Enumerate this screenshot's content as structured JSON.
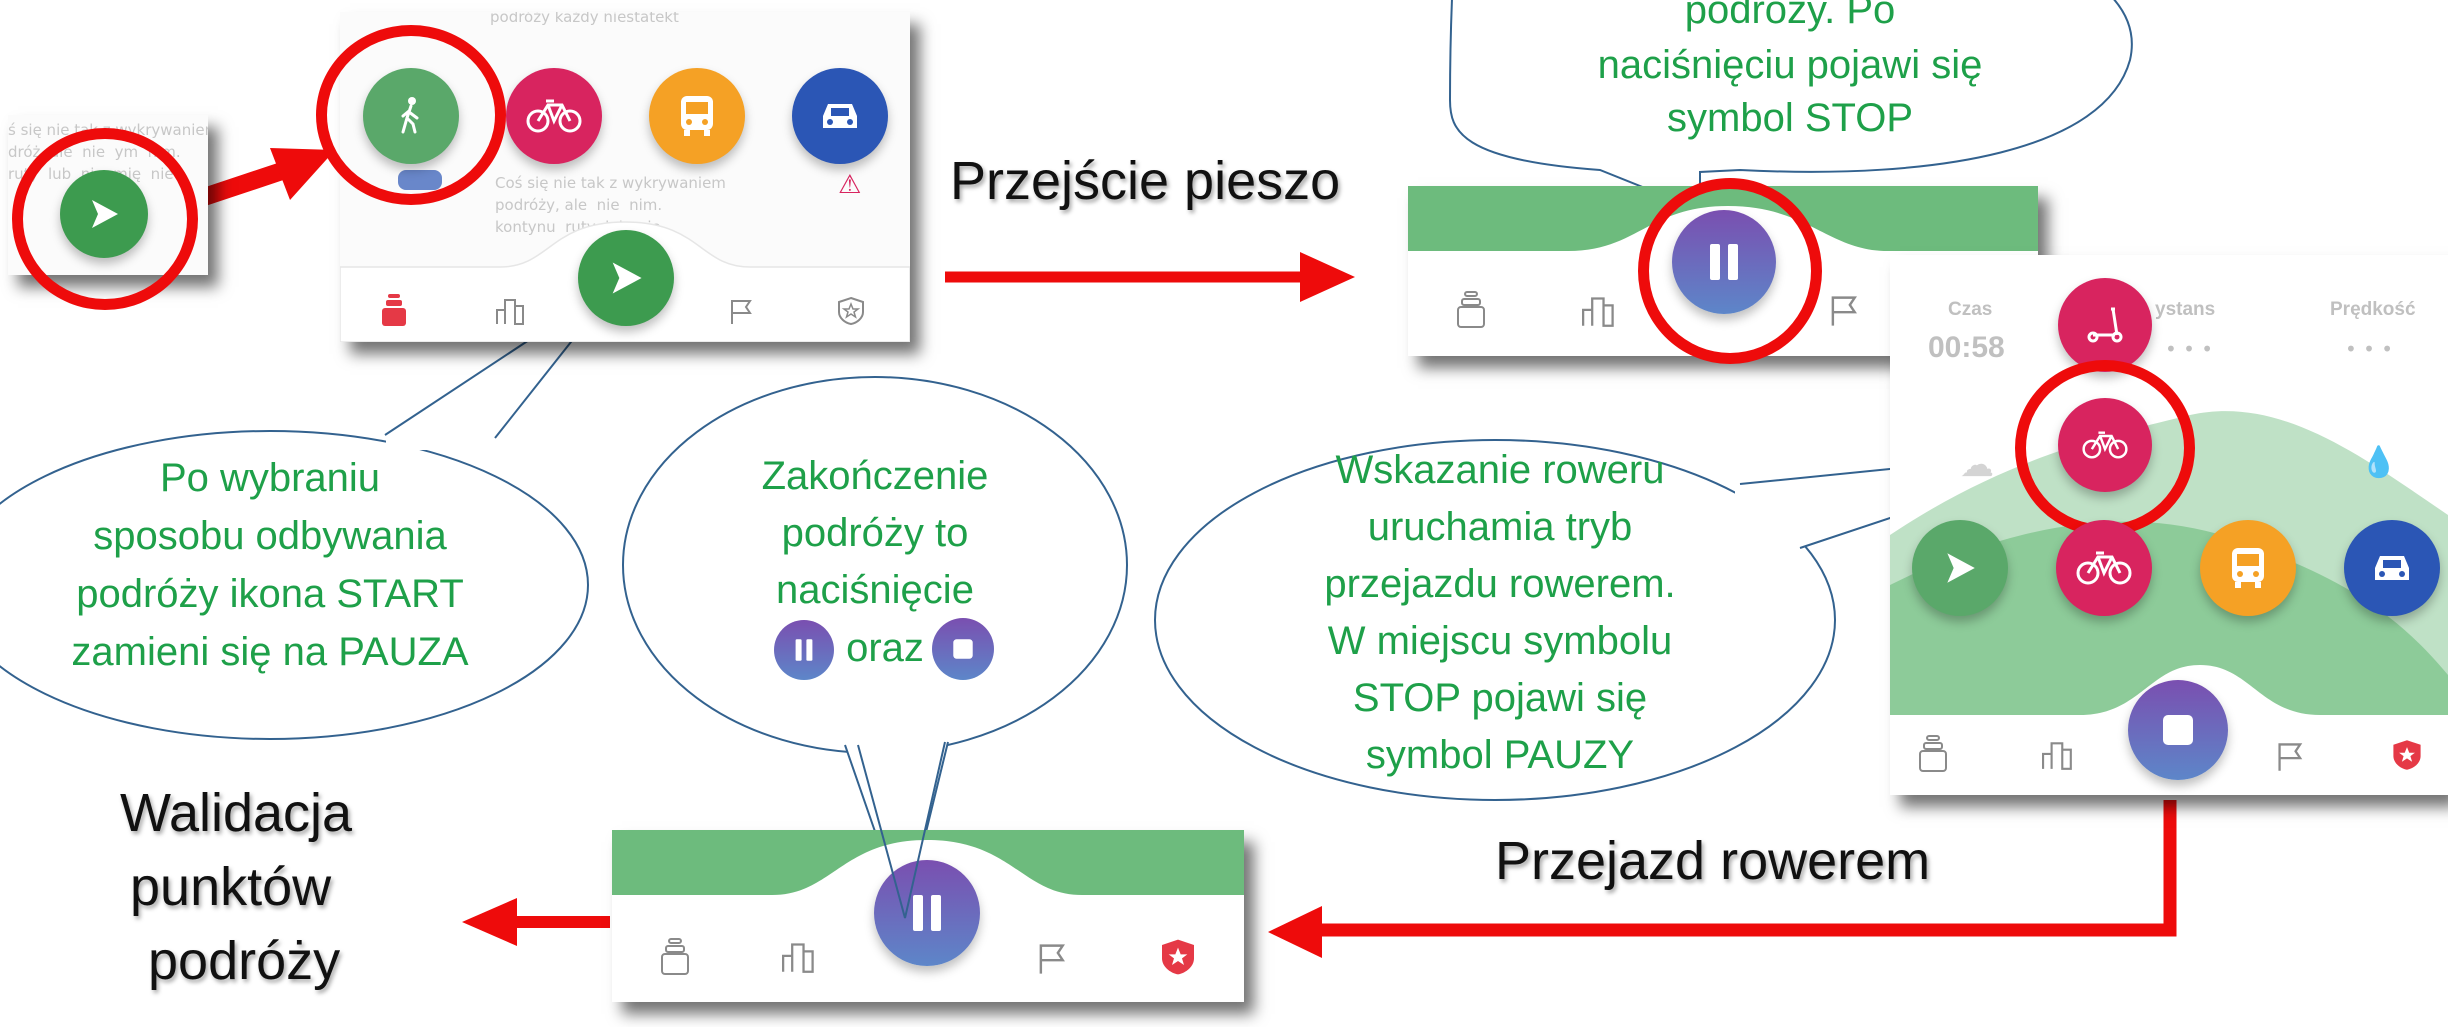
{
  "labels": {
    "walking": "Przejście pieszo",
    "cycling": "Przejazd rowerem",
    "validation_line1": "Walidacja",
    "validation_line2": "punktów",
    "validation_line3": "podróży"
  },
  "bubbles": {
    "top": [
      "podróży. Po",
      "naciśnięciu pojawi się",
      "symbol STOP"
    ],
    "start": [
      "Po wybraniu",
      "sposobu odbywania",
      "podróży ikona START",
      "zamieni się na PAUZA"
    ],
    "end": [
      "Zakończenie",
      "podróży to",
      "naciśnięcie",
      "oraz"
    ],
    "bike": [
      "Wskazanie roweru",
      "uruchamia tryb",
      "przejazdu rowerem.",
      "W miejscu symbolu",
      "STOP pojawi się",
      "symbol PAUZY"
    ]
  },
  "background_text": {
    "left_panel": [
      "ś się nie tak z wykrywaniem",
      "dróż  ałe  nie  ym  nim.",
      "ruty  lub  nie  mię  nie"
    ],
    "mode_panel": [
      "Coś się nie tak z wykrywaniem",
      "podróży, ale  nie  nim.",
      "kontynu  ruty  lub  nie"
    ],
    "mode_panel_top": "podróży każdy niestatekt"
  },
  "stats": {
    "time_label": "Czas",
    "time_value": "00:58",
    "distance_label": "ystans",
    "speed_label": "Prędkość"
  },
  "colors": {
    "arrow": "#ee0b0b",
    "ring": "#ee0b0b",
    "bubble_text": "#1ea049",
    "green_wave": "#6dbb7d",
    "start_button": "#3d9b4f",
    "bike_button": "#d8245f",
    "bus_button": "#f5a125",
    "car_button": "#2b56b5"
  },
  "icons": [
    "play-icon",
    "pedestrian-icon",
    "bicycle-icon",
    "bus-icon",
    "car-icon",
    "pause-icon",
    "stop-icon",
    "scooter-icon",
    "stack-icon",
    "stats-icon",
    "flag-icon",
    "star-badge-icon"
  ]
}
